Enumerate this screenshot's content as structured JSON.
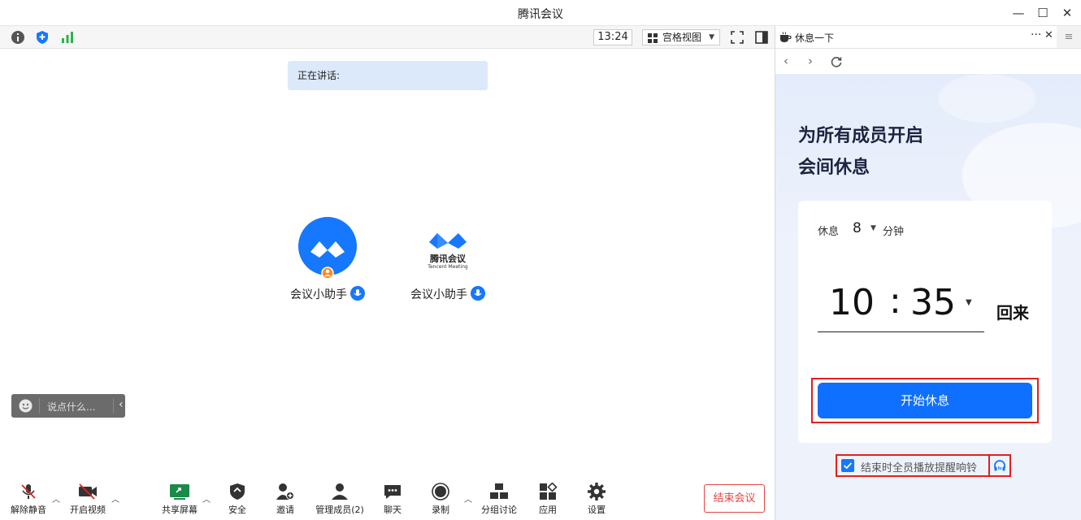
{
  "window": {
    "title": "腾讯会议"
  },
  "toolbar": {
    "time": "13:24",
    "view_label": "宫格视图"
  },
  "main": {
    "speaking_label": "正在讲话:",
    "participants": [
      {
        "name": "会议小助手"
      },
      {
        "name": "会议小助手",
        "logo_cn": "腾讯会议",
        "logo_en": "Tencent Meeting"
      }
    ],
    "chat_placeholder": "说点什么..."
  },
  "bottom": {
    "unmute": "解除静音",
    "video": "开启视频",
    "share": "共享屏幕",
    "security": "安全",
    "invite": "邀请",
    "members": "管理成员(2)",
    "chat": "聊天",
    "record": "录制",
    "breakout": "分组讨论",
    "apps": "应用",
    "settings": "设置",
    "end": "结束会议"
  },
  "panel": {
    "tab_title": "休息一下",
    "heading_line1": "为所有成员开启",
    "heading_line2": "会间休息",
    "rest_label": "休息",
    "rest_minutes": "8",
    "rest_unit": "分钟",
    "return_hour": "10",
    "return_colon": ":",
    "return_minute": "35",
    "return_label": "回来",
    "start_button": "开始休息",
    "ring_label": "结束时全员播放提醒响铃",
    "ring_checked": true
  },
  "colors": {
    "accent": "#0f6fff",
    "danger": "#e64545",
    "highlight": "#e02020"
  }
}
